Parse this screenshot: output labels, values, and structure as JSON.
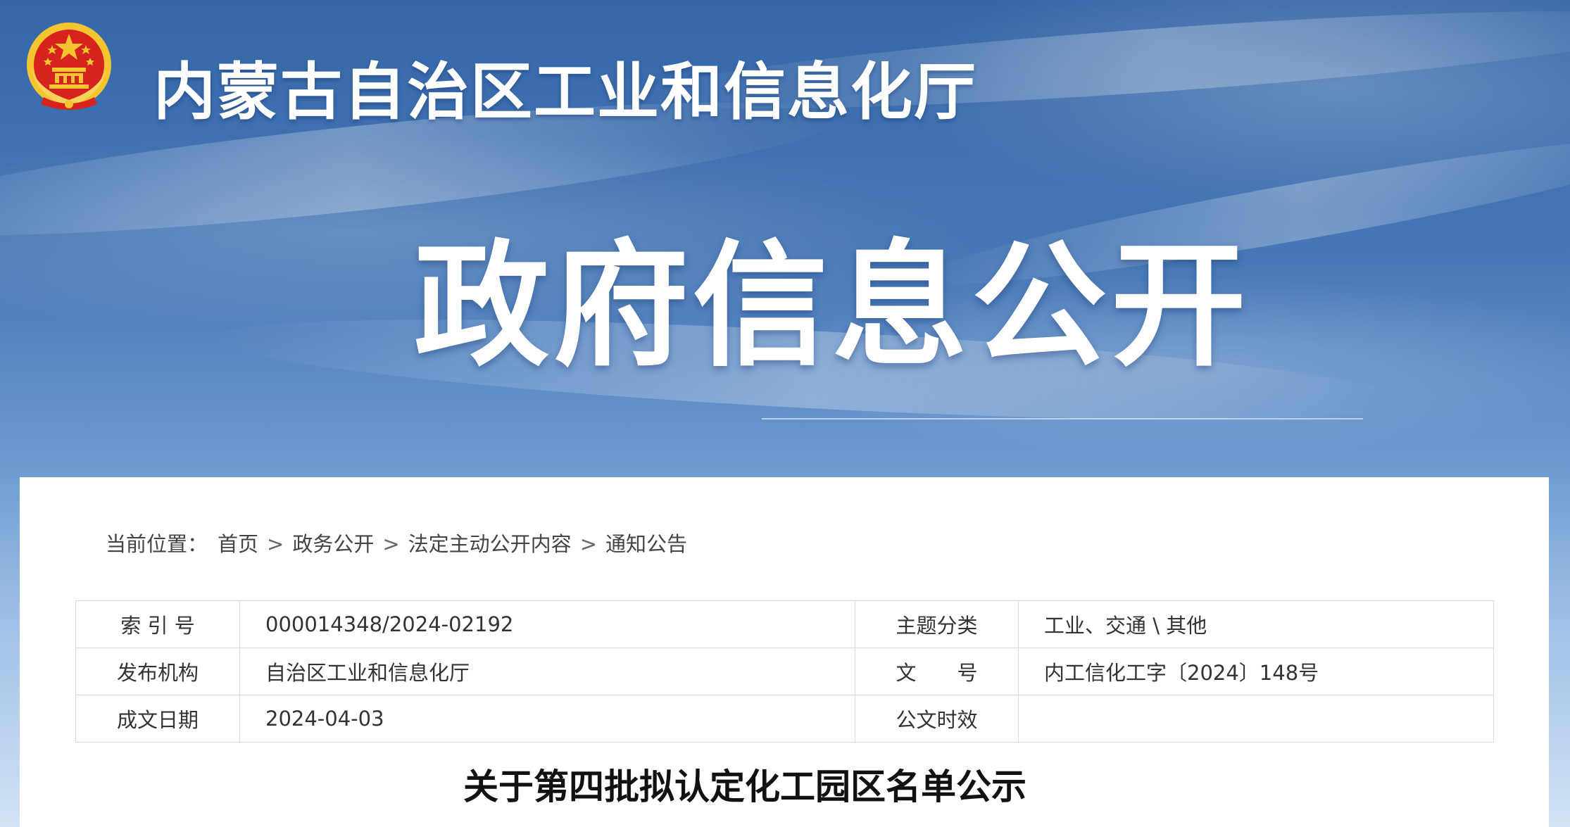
{
  "header": {
    "site_title": "内蒙古自治区工业和信息化厅",
    "section_title": "政府信息公开",
    "emblem_icon": "national-emblem-icon"
  },
  "breadcrumb": {
    "prefix": "当前位置：",
    "items": [
      "首页",
      "政务公开",
      "法定主动公开内容",
      "通知公告"
    ],
    "separator": ">"
  },
  "metadata": {
    "rows": [
      [
        {
          "label": "索 引 号",
          "value": "000014348/2024-02192"
        },
        {
          "label": "主题分类",
          "value": "工业、交通 \\ 其他"
        }
      ],
      [
        {
          "label": "发布机构",
          "value": "自治区工业和信息化厅"
        },
        {
          "label": "文　　号",
          "value": "内工信化工字〔2024〕148号"
        }
      ],
      [
        {
          "label": "成文日期",
          "value": "2024-04-03"
        },
        {
          "label": "公文时效",
          "value": ""
        }
      ]
    ]
  },
  "document": {
    "title": "关于第四批拟认定化工园区名单公示"
  },
  "colors": {
    "banner_top": "#3566a7",
    "banner_bottom": "#d2e2f4",
    "emblem_red": "#d7231e",
    "emblem_gold": "#f4c531"
  }
}
